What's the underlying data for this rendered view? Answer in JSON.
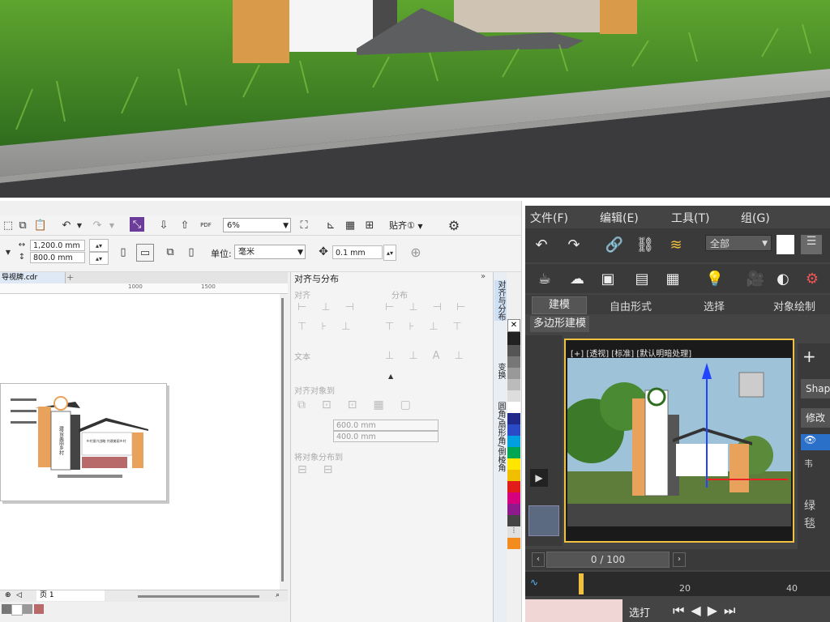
{
  "corel": {
    "toolbar1": {
      "zoom_value": "6%",
      "snap_label": "贴齐",
      "snap_shortcut": "①",
      "pdf_label": "PDF"
    },
    "toolbar2": {
      "width_value": "1,200.0 mm",
      "height_value": "800.0 mm",
      "units_label": "单位:",
      "units_value": "毫米",
      "nudge_value": "0.1 mm"
    },
    "doc_tab": "导视牌.cdr",
    "ruler_ticks": [
      "1000",
      "1500"
    ],
    "page_tab": "页 1",
    "sign_text_1": "建设美丽乡村",
    "sign_text_2": "乡村振兴战略 共建美丽乡村",
    "docker": {
      "title": "对齐与分布",
      "align_section": "对齐",
      "distribute_section": "分布",
      "text_section": "文本",
      "align_to_section": "对齐对象到",
      "field_x": "600.0 mm",
      "field_y": "400.0 mm",
      "distribute_to_section": "将对象分布到"
    },
    "side_tabs": [
      "对齐与分布",
      "变换",
      "圆角/扇形角/倒棱角"
    ]
  },
  "max": {
    "menu": [
      "文件(F)",
      "编辑(E)",
      "工具(T)",
      "组(G)"
    ],
    "selection_set": "全部",
    "ribbon_tabs": [
      "建模",
      "自由形式",
      "选择",
      "对象绘制"
    ],
    "sub_label": "多边形建模",
    "viewport_label": "[+] [透视] [标准] [默认明暗处理]",
    "right_shape": "Shap",
    "right_modify": "修改",
    "right_letters": [
      "韦",
      "绿",
      "毯"
    ],
    "timeline_value": "0 / 100",
    "ticks": [
      "20",
      "40"
    ],
    "bottom_label": "选打"
  },
  "colors": {
    "corel_bg": "#f0f0f0",
    "max_bg": "#444444",
    "max_accent": "#ffcc33",
    "grass": "#4f8f2a"
  }
}
